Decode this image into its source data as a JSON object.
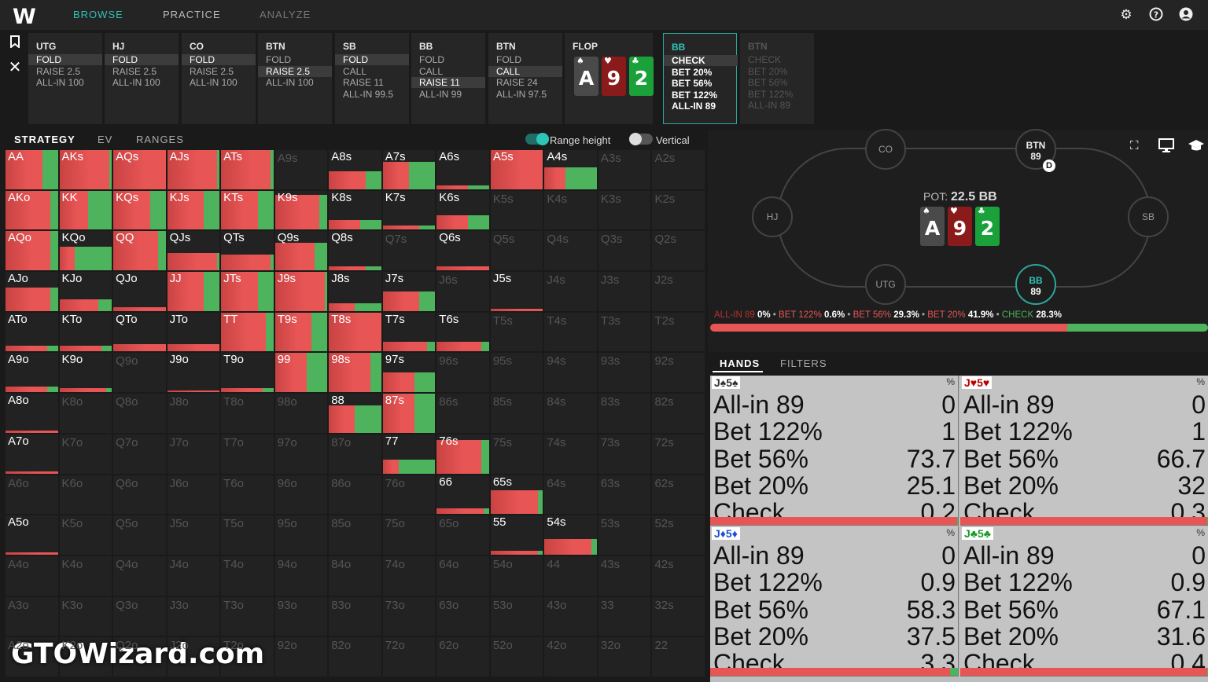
{
  "app": {
    "logo": "W"
  },
  "nav": {
    "tabs": [
      {
        "label": "BROWSE",
        "active": true
      },
      {
        "label": "PRACTICE"
      },
      {
        "label": "ANALYZE"
      }
    ]
  },
  "topbar_icons": [
    "settings-icon",
    "help-icon",
    "account-icon"
  ],
  "sidebar_icons": [
    "bookmark-icon",
    "close-icon"
  ],
  "action_seats": [
    {
      "name": "UTG",
      "actions": [
        "FOLD",
        "RAISE 2.5",
        "ALL-IN 100"
      ],
      "selected": 0
    },
    {
      "name": "HJ",
      "actions": [
        "FOLD",
        "RAISE 2.5",
        "ALL-IN 100"
      ],
      "selected": 0
    },
    {
      "name": "CO",
      "actions": [
        "FOLD",
        "RAISE 2.5",
        "ALL-IN 100"
      ],
      "selected": 0
    },
    {
      "name": "BTN",
      "actions": [
        "FOLD",
        "RAISE 2.5",
        "ALL-IN 100"
      ],
      "selected": 1
    },
    {
      "name": "SB",
      "actions": [
        "FOLD",
        "CALL",
        "RAISE 11",
        "ALL-IN 99.5"
      ],
      "selected": 0
    },
    {
      "name": "BB",
      "actions": [
        "FOLD",
        "CALL",
        "RAISE 11",
        "ALL-IN 99"
      ],
      "selected": 2
    },
    {
      "name": "BTN",
      "actions": [
        "FOLD",
        "CALL",
        "RAISE 24",
        "ALL-IN 97.5"
      ],
      "selected": 1
    }
  ],
  "flop": {
    "label": "FLOP",
    "cards": [
      {
        "rank": "A",
        "suit": "♠",
        "color": "#4a4a4a"
      },
      {
        "rank": "9",
        "suit": "♥",
        "color": "#8b1a1a"
      },
      {
        "rank": "2",
        "suit": "♣",
        "color": "#1aa13a"
      }
    ]
  },
  "active_seat": {
    "name": "BB",
    "actions": [
      "CHECK",
      "BET 20%",
      "BET 56%",
      "BET 122%",
      "ALL-IN 89"
    ],
    "selected": 0
  },
  "next_seat": {
    "name": "BTN",
    "actions": [
      "CHECK",
      "BET 20%",
      "BET 56%",
      "BET 122%",
      "ALL-IN 89"
    ]
  },
  "strategy_tabs": [
    "STRATEGY",
    "EV",
    "RANGES"
  ],
  "toggles": [
    {
      "label": "Range height",
      "on": true
    },
    {
      "label": "Vertical",
      "on": false
    }
  ],
  "colors": {
    "bet": "#e85555",
    "bet_dark": "#c94343",
    "check": "#4db35c",
    "accent": "#2ec4b6",
    "allin": "#b83030"
  },
  "table": {
    "pot_label": "POT:",
    "pot_value": "22.5 BB",
    "board": [
      "A",
      "9",
      "2"
    ]
  },
  "positions": [
    {
      "name": "CO"
    },
    {
      "name": "BTN",
      "stack": "89",
      "dealer": "D"
    },
    {
      "name": "HJ"
    },
    {
      "name": "SB"
    },
    {
      "name": "UTG"
    },
    {
      "name": "BB",
      "stack": "89",
      "hero": true
    }
  ],
  "table_icons": [
    "fullscreen-icon",
    "monitor-icon",
    "study-icon"
  ],
  "summary": [
    {
      "label": "ALL-IN 89",
      "pct": "0%",
      "color": "#b83030"
    },
    {
      "label": "BET 122%",
      "pct": "0.6%",
      "color": "#e85555"
    },
    {
      "label": "BET 56%",
      "pct": "29.3%",
      "color": "#e85555"
    },
    {
      "label": "BET 20%",
      "pct": "41.9%",
      "color": "#e85555"
    },
    {
      "label": "CHECK",
      "pct": "28.3%",
      "color": "#4db35c"
    }
  ],
  "summary_bar": {
    "bet": 71.8,
    "check": 28.3
  },
  "hands_tabs": [
    "HANDS",
    "FILTERS"
  ],
  "hands": [
    {
      "hand": "J♠5♠",
      "color": "#333",
      "rows": [
        [
          "All-in 89",
          "0"
        ],
        [
          "Bet 122%",
          "1"
        ],
        [
          "Bet 56%",
          "73.7"
        ],
        [
          "Bet 20%",
          "25.1"
        ],
        [
          "Check",
          "0.2"
        ]
      ]
    },
    {
      "hand": "J♥5♥",
      "color": "#b00",
      "rows": [
        [
          "All-in 89",
          "0"
        ],
        [
          "Bet 122%",
          "1"
        ],
        [
          "Bet 56%",
          "66.7"
        ],
        [
          "Bet 20%",
          "32"
        ],
        [
          "Check",
          "0.3"
        ]
      ]
    },
    {
      "hand": "J♦5♦",
      "color": "#1a4fd6",
      "rows": [
        [
          "All-in 89",
          "0"
        ],
        [
          "Bet 122%",
          "0.9"
        ],
        [
          "Bet 56%",
          "58.3"
        ],
        [
          "Bet 20%",
          "37.5"
        ],
        [
          "Check",
          "3.3"
        ]
      ]
    },
    {
      "hand": "J♣5♣",
      "color": "#1a9a2a",
      "rows": [
        [
          "All-in 89",
          "0"
        ],
        [
          "Bet 122%",
          "0.9"
        ],
        [
          "Bet 56%",
          "67.1"
        ],
        [
          "Bet 20%",
          "31.6"
        ],
        [
          "Check",
          "0.4"
        ]
      ]
    }
  ],
  "hand_pct_label": "%",
  "grid": [
    [
      "AA",
      "AKs",
      "AQs",
      "AJs",
      "ATs",
      "A9s",
      "A8s",
      "A7s",
      "A6s",
      "A5s",
      "A4s",
      "A3s",
      "A2s"
    ],
    [
      "AKo",
      "KK",
      "KQs",
      "KJs",
      "KTs",
      "K9s",
      "K8s",
      "K7s",
      "K6s",
      "K5s",
      "K4s",
      "K3s",
      "K2s"
    ],
    [
      "AQo",
      "KQo",
      "QQ",
      "QJs",
      "QTs",
      "Q9s",
      "Q8s",
      "Q7s",
      "Q6s",
      "Q5s",
      "Q4s",
      "Q3s",
      "Q2s"
    ],
    [
      "AJo",
      "KJo",
      "QJo",
      "JJ",
      "JTs",
      "J9s",
      "J8s",
      "J7s",
      "J6s",
      "J5s",
      "J4s",
      "J3s",
      "J2s"
    ],
    [
      "ATo",
      "KTo",
      "QTo",
      "JTo",
      "TT",
      "T9s",
      "T8s",
      "T7s",
      "T6s",
      "T5s",
      "T4s",
      "T3s",
      "T2s"
    ],
    [
      "A9o",
      "K9o",
      "Q9o",
      "J9o",
      "T9o",
      "99",
      "98s",
      "97s",
      "96s",
      "95s",
      "94s",
      "93s",
      "92s"
    ],
    [
      "A8o",
      "K8o",
      "Q8o",
      "J8o",
      "T8o",
      "98o",
      "88",
      "87s",
      "86s",
      "85s",
      "84s",
      "83s",
      "82s"
    ],
    [
      "A7o",
      "K7o",
      "Q7o",
      "J7o",
      "T7o",
      "97o",
      "87o",
      "77",
      "76s",
      "75s",
      "74s",
      "73s",
      "72s"
    ],
    [
      "A6o",
      "K6o",
      "Q6o",
      "J6o",
      "T6o",
      "96o",
      "86o",
      "76o",
      "66",
      "65s",
      "64s",
      "63s",
      "62s"
    ],
    [
      "A5o",
      "K5o",
      "Q5o",
      "J5o",
      "T5o",
      "95o",
      "85o",
      "75o",
      "65o",
      "55",
      "54s",
      "53s",
      "52s"
    ],
    [
      "A4o",
      "K4o",
      "Q4o",
      "J4o",
      "T4o",
      "94o",
      "84o",
      "74o",
      "64o",
      "54o",
      "44",
      "43s",
      "42s"
    ],
    [
      "A3o",
      "K3o",
      "Q3o",
      "J3o",
      "T3o",
      "93o",
      "83o",
      "73o",
      "63o",
      "53o",
      "43o",
      "33",
      "32s"
    ],
    [
      "A2o",
      "K2o",
      "Q2o",
      "J2o",
      "T2o",
      "92o",
      "82o",
      "72o",
      "62o",
      "52o",
      "42o",
      "32o",
      "22"
    ]
  ],
  "range_weights": {
    "AA": [
      1,
      0.7,
      0.3
    ],
    "AKs": [
      1,
      0.95,
      0.05
    ],
    "AQs": [
      1,
      1,
      0
    ],
    "AJs": [
      1,
      0.95,
      0.05
    ],
    "ATs": [
      1,
      0.95,
      0.05
    ],
    "A8s": [
      0.45,
      0.7,
      0.3
    ],
    "A7s": [
      0.7,
      0.5,
      0.5
    ],
    "A6s": [
      0.1,
      0.6,
      0.4
    ],
    "A5s": [
      1,
      1,
      0
    ],
    "A4s": [
      0.55,
      0.4,
      0.6
    ],
    "AKo": [
      1,
      0.85,
      0.15
    ],
    "KK": [
      1,
      0.55,
      0.45
    ],
    "KQs": [
      1,
      0.7,
      0.3
    ],
    "KJs": [
      1,
      0.7,
      0.3
    ],
    "KTs": [
      1,
      0.7,
      0.3
    ],
    "K9s": [
      0.9,
      0.85,
      0.15
    ],
    "K8s": [
      0.25,
      0.6,
      0.4
    ],
    "K7s": [
      0.1,
      0.7,
      0.3
    ],
    "K6s": [
      0.38,
      0.6,
      0.4
    ],
    "AQo": [
      1,
      0.85,
      0.15
    ],
    "KQo": [
      0.6,
      0.3,
      0.7
    ],
    "QQ": [
      1,
      0.85,
      0.15
    ],
    "QJs": [
      0.45,
      0.95,
      0.05
    ],
    "QTs": [
      0.4,
      0.95,
      0.05
    ],
    "Q9s": [
      0.7,
      0.75,
      0.25
    ],
    "Q8s": [
      0.1,
      0.7,
      0.3
    ],
    "Q6s": [
      0.1,
      1,
      0
    ],
    "AJo": [
      0.6,
      0.85,
      0.15
    ],
    "KJo": [
      0.3,
      0.75,
      0.25
    ],
    "QJo": [
      0.1,
      1,
      0
    ],
    "JJ": [
      1,
      0.7,
      0.3
    ],
    "JTs": [
      1,
      0.7,
      0.3
    ],
    "J9s": [
      1,
      0.95,
      0.05
    ],
    "J8s": [
      0.2,
      0.5,
      0.5
    ],
    "J7s": [
      0.5,
      0.7,
      0.3
    ],
    "J5s": [
      0.05,
      1,
      0
    ],
    "ATo": [
      0.15,
      0.8,
      0.2
    ],
    "KTo": [
      0.15,
      0.8,
      0.2
    ],
    "QTo": [
      0.2,
      1,
      0
    ],
    "JTo": [
      0.2,
      1,
      0
    ],
    "TT": [
      1,
      0.85,
      0.15
    ],
    "T9s": [
      1,
      0.7,
      0.3
    ],
    "T8s": [
      1,
      1,
      0
    ],
    "T7s": [
      0.25,
      0.85,
      0.15
    ],
    "T6s": [
      0.25,
      0.85,
      0.15
    ],
    "A9o": [
      0.15,
      0.8,
      0.2
    ],
    "K9o": [
      0.1,
      0.9,
      0.1
    ],
    "J9o": [
      0.05,
      1,
      0
    ],
    "T9o": [
      0.1,
      0.8,
      0.2
    ],
    "99": [
      1,
      0.6,
      0.4
    ],
    "98s": [
      1,
      0.8,
      0.2
    ],
    "97s": [
      0.5,
      0.6,
      0.4
    ],
    "A8o": [
      0.05,
      1,
      0
    ],
    "88": [
      0.7,
      0.5,
      0.5
    ],
    "87s": [
      1,
      0.6,
      0.4
    ],
    "A7o": [
      0.05,
      1,
      0
    ],
    "77": [
      0.35,
      0.3,
      0.7
    ],
    "76s": [
      0.85,
      0.85,
      0.15
    ],
    "66": [
      0.15,
      0.9,
      0.1
    ],
    "65s": [
      0.6,
      0.9,
      0.1
    ],
    "A5o": [
      0.05,
      1,
      0
    ],
    "55": [
      0.1,
      0.9,
      0.1
    ],
    "54s": [
      0.4,
      0.9,
      0.1
    ]
  },
  "watermark": "GTOWizard.com"
}
